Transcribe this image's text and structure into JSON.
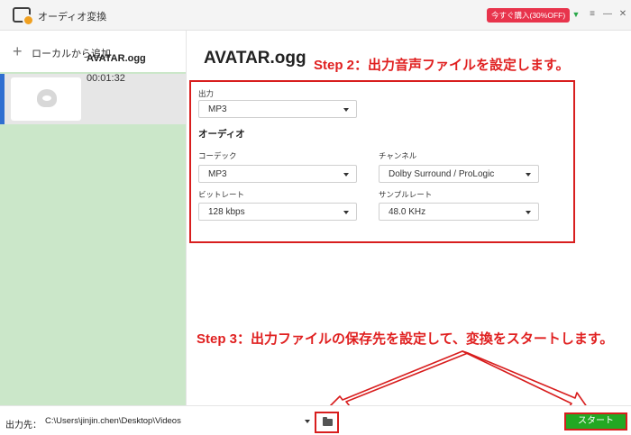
{
  "titlebar": {
    "title": "オーディオ変換",
    "promo": "今すぐ購入(30%OFF)",
    "icons": [
      "gift-icon",
      "menu-icon",
      "minimize-icon",
      "close-icon"
    ]
  },
  "sidebar": {
    "add_label": "ローカルから追加",
    "file": {
      "name": "AVATAR.ogg",
      "duration": "00:01:32"
    }
  },
  "main": {
    "title": "AVATAR.ogg",
    "step2": "Step 2：出力音声ファイルを設定します。",
    "output_label": "出力",
    "output_value": "MP3",
    "audio_section": "オーディオ",
    "codec_label": "コーデック",
    "codec_value": "MP3",
    "channel_label": "チャンネル",
    "channel_value": "Dolby Surround / ProLogic",
    "bitrate_label": "ビットレート",
    "bitrate_value": "128 kbps",
    "samplerate_label": "サンプルレート",
    "samplerate_value": "48.0 KHz",
    "step3": "Step 3：出力ファイルの保存先を設定して、変換をスタートします。"
  },
  "bottombar": {
    "output_dest_label": "出力先：",
    "path": "C:\\Users\\jinjin.chen\\Desktop\\Videos",
    "start_label": "スタート"
  },
  "colors": {
    "annotation_red": "#e02020",
    "start_green": "#23a823",
    "sidebar_green": "#cbe7c9",
    "promo_red": "#e8344c"
  }
}
